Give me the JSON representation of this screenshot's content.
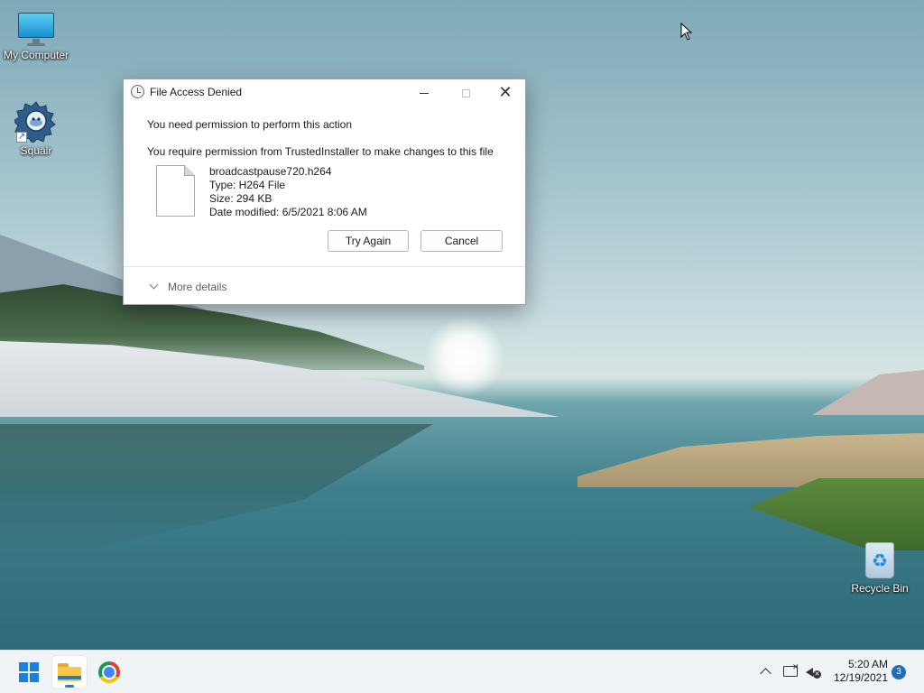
{
  "desktop": {
    "icons": [
      {
        "label": "My Computer",
        "icon": "monitor-icon"
      },
      {
        "label": "Squalr",
        "icon": "squalr-gear-icon"
      },
      {
        "label": "Recycle Bin",
        "icon": "recycle-bin-icon"
      }
    ]
  },
  "dialog": {
    "title": "File Access Denied",
    "title_icon": "clock-icon",
    "message_primary": "You need permission to perform this action",
    "message_secondary": "You require permission from TrustedInstaller to make changes to this file",
    "file": {
      "name": "broadcastpause720.h264",
      "type": "Type: H264 File",
      "size": "Size: 294 KB",
      "date_modified": "Date modified: 6/5/2021 8:06 AM"
    },
    "buttons": {
      "try_again": "Try Again",
      "cancel": "Cancel"
    },
    "more_details": "More details"
  },
  "taskbar": {
    "apps": [
      "start-icon",
      "file-explorer-icon",
      "chrome-icon"
    ],
    "tray": [
      "chevron-up-icon",
      "network-disconnected-icon",
      "volume-muted-icon"
    ],
    "clock": {
      "time": "5:20 AM",
      "date": "12/19/2021"
    },
    "notification_count": "3",
    "accent": "#1e7fd9"
  }
}
